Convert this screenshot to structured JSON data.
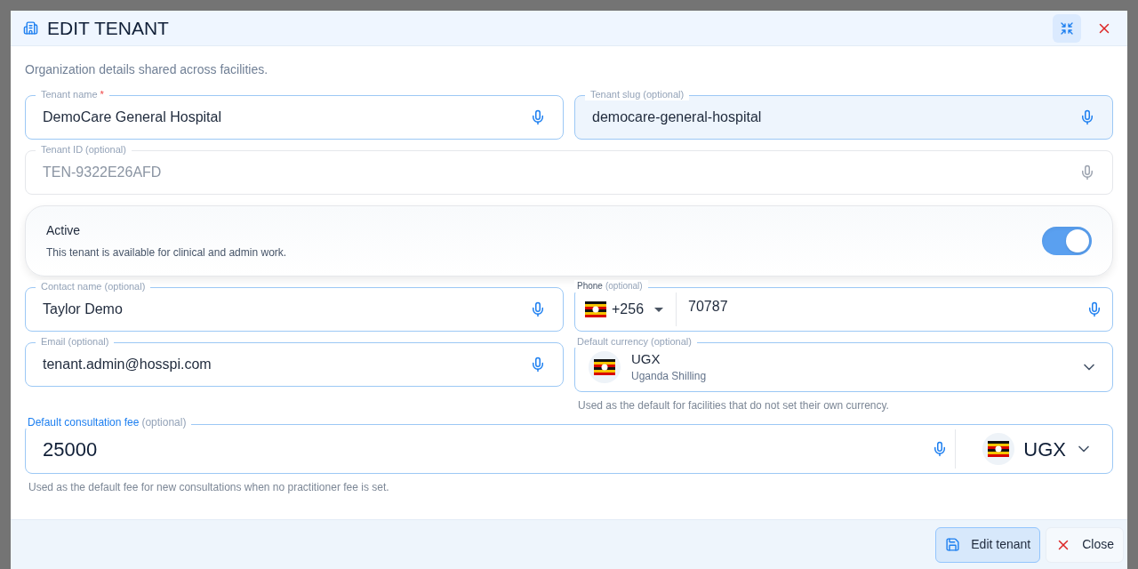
{
  "dialog": {
    "title": "EDIT TENANT",
    "description": "Organization details shared across facilities.",
    "rows": [
      {
        "fields": [
          {
            "kind": "text",
            "label": "Tenant name",
            "required_mark": "*",
            "value": "DemoCare General Hospital",
            "disabled": false,
            "highlighted": false
          },
          {
            "kind": "text",
            "label": "Tenant slug",
            "hint": "(optional)",
            "value": "democare-general-hospital",
            "disabled": false,
            "highlighted": true
          }
        ]
      },
      {
        "fields": [
          {
            "kind": "text",
            "label": "Tenant ID",
            "hint": "(optional)",
            "value": "TEN-9322E26AFD",
            "disabled": true,
            "highlighted": false
          }
        ]
      },
      {
        "fields": [
          {
            "kind": "toggle",
            "label": "Active",
            "description": "This tenant is available for clinical and admin work.",
            "on": true
          }
        ]
      },
      {
        "fields": [
          {
            "kind": "text",
            "label": "Contact name",
            "hint": "(optional)",
            "value": "Taylor Demo",
            "disabled": false,
            "highlighted": false
          },
          {
            "kind": "phone",
            "label": "Phone",
            "hint": "(optional)",
            "dial_code": "+256",
            "value": "70787"
          }
        ]
      },
      {
        "fields": [
          {
            "kind": "text",
            "label": "Email",
            "hint": "(optional)",
            "value": "tenant.admin@hosspi.com",
            "disabled": false,
            "highlighted": false
          },
          {
            "kind": "currency",
            "label": "Default currency",
            "hint": "(optional)",
            "code": "UGX",
            "name": "Uganda Shilling",
            "helper": "Used as the default for facilities that do not set their own currency."
          }
        ]
      },
      {
        "fields": [
          {
            "kind": "fee",
            "label": "Default consultation fee",
            "hint": "(optional)",
            "value": "25000",
            "currency": "UGX",
            "focused": true,
            "helper": "Used as the default fee for new consultations when no practitioner fee is set."
          }
        ]
      }
    ],
    "buttons": [
      {
        "kind": "primary",
        "label": "Edit tenant"
      },
      {
        "kind": "secondary",
        "label": "Close"
      }
    ]
  }
}
